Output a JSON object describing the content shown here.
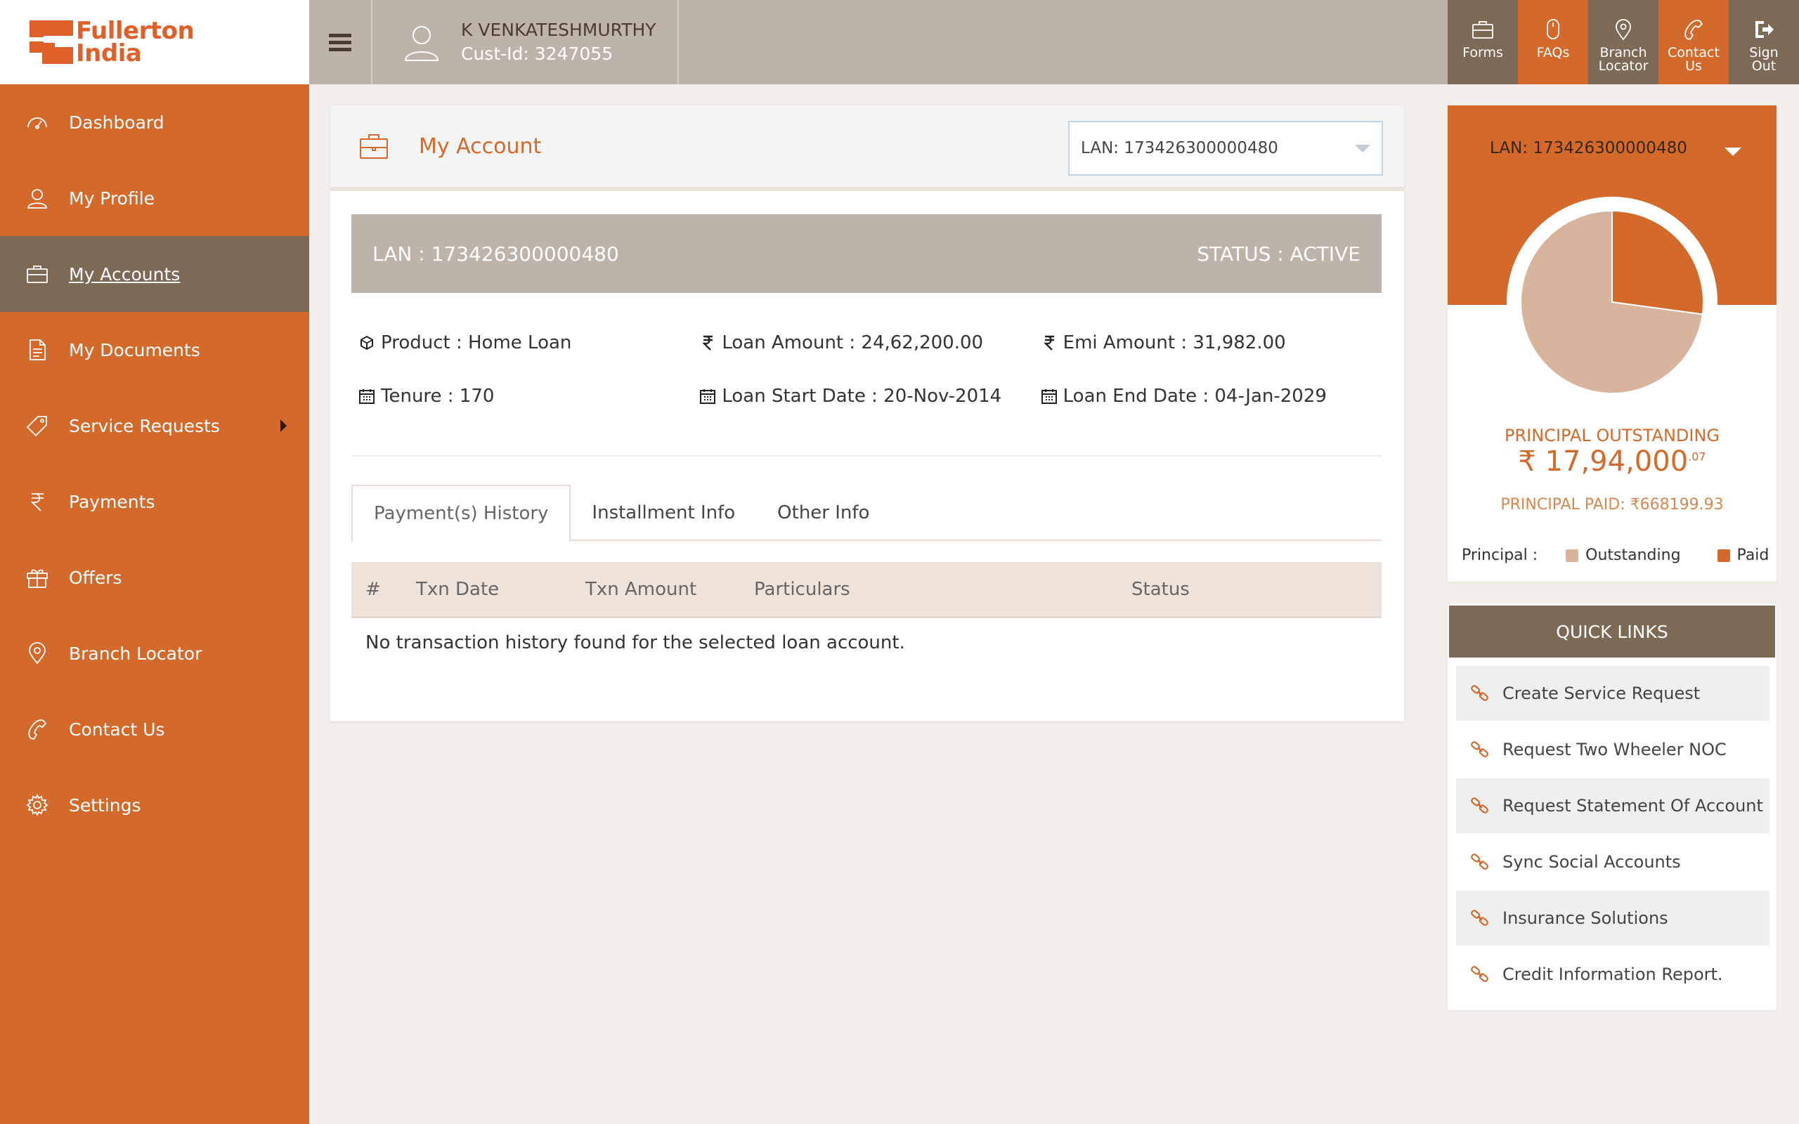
{
  "brand": {
    "line1": "Fullerton",
    "line2": "India"
  },
  "header": {
    "user_name": "K VENKATESHMURTHY",
    "cust_id": "Cust-Id: 3247055",
    "actions": [
      {
        "label": "Forms",
        "icon": "briefcase-icon"
      },
      {
        "label": "FAQs",
        "icon": "mouse-icon"
      },
      {
        "label": "Branch Locator",
        "icon": "map-pin-icon"
      },
      {
        "label": "Contact Us",
        "icon": "phone-icon"
      },
      {
        "label": "Sign Out",
        "icon": "sign-out-icon"
      }
    ]
  },
  "sidebar": {
    "items": [
      {
        "label": "Dashboard",
        "icon": "speedometer-icon"
      },
      {
        "label": "My Profile",
        "icon": "user-icon"
      },
      {
        "label": "My Accounts",
        "icon": "briefcase-icon",
        "active": true
      },
      {
        "label": "My Documents",
        "icon": "document-icon"
      },
      {
        "label": "Service Requests",
        "icon": "tag-icon",
        "submenu": true
      },
      {
        "label": "Payments",
        "icon": "rupee-icon"
      },
      {
        "label": "Offers",
        "icon": "gift-icon"
      },
      {
        "label": "Branch Locator",
        "icon": "map-pin-icon"
      },
      {
        "label": "Contact Us",
        "icon": "phone-icon"
      },
      {
        "label": "Settings",
        "icon": "gear-icon"
      }
    ]
  },
  "account": {
    "title": "My Account",
    "lan_select": "LAN: 173426300000480",
    "lan_bar": "LAN : 173426300000480",
    "status": "STATUS : ACTIVE",
    "product": "Product : Home Loan",
    "loan_amount": "Loan Amount : 24,62,200.00",
    "emi_amount": "Emi Amount : 31,982.00",
    "tenure": "Tenure : 170",
    "start_date": "Loan Start Date : 20-Nov-2014",
    "end_date": "Loan End Date : 04-Jan-2029"
  },
  "tabs": [
    {
      "label": "Payment(s) History",
      "active": true
    },
    {
      "label": "Installment Info"
    },
    {
      "label": "Other Info"
    }
  ],
  "table": {
    "headers": [
      "#",
      "Txn Date",
      "Txn Amount",
      "Particulars",
      "Status"
    ],
    "empty_message": "No transaction history found for the selected loan account."
  },
  "chart_panel": {
    "lan": "LAN: 173426300000480",
    "principal_outstanding_label": "PRINCIPAL OUTSTANDING",
    "principal_outstanding_value": "17,94,000",
    "principal_outstanding_decimal": ".07",
    "principal_paid_label": "PRINCIPAL PAID:",
    "principal_paid_value": "668199.93",
    "legend_title": "Principal :",
    "legend_outstanding": "Outstanding",
    "legend_paid": "Paid",
    "colors": {
      "outstanding": "#d9b49d",
      "paid": "#d36a2b"
    }
  },
  "chart_data": {
    "type": "pie",
    "categories": [
      "Outstanding",
      "Paid"
    ],
    "values": [
      1794000.07,
      668199.93
    ]
  },
  "quick_links": {
    "title": "QUICK LINKS",
    "items": [
      "Create Service Request",
      "Request Two Wheeler NOC",
      "Request Statement Of Account",
      "Sync Social Accounts",
      "Insurance Solutions",
      "Credit Information Report."
    ]
  }
}
